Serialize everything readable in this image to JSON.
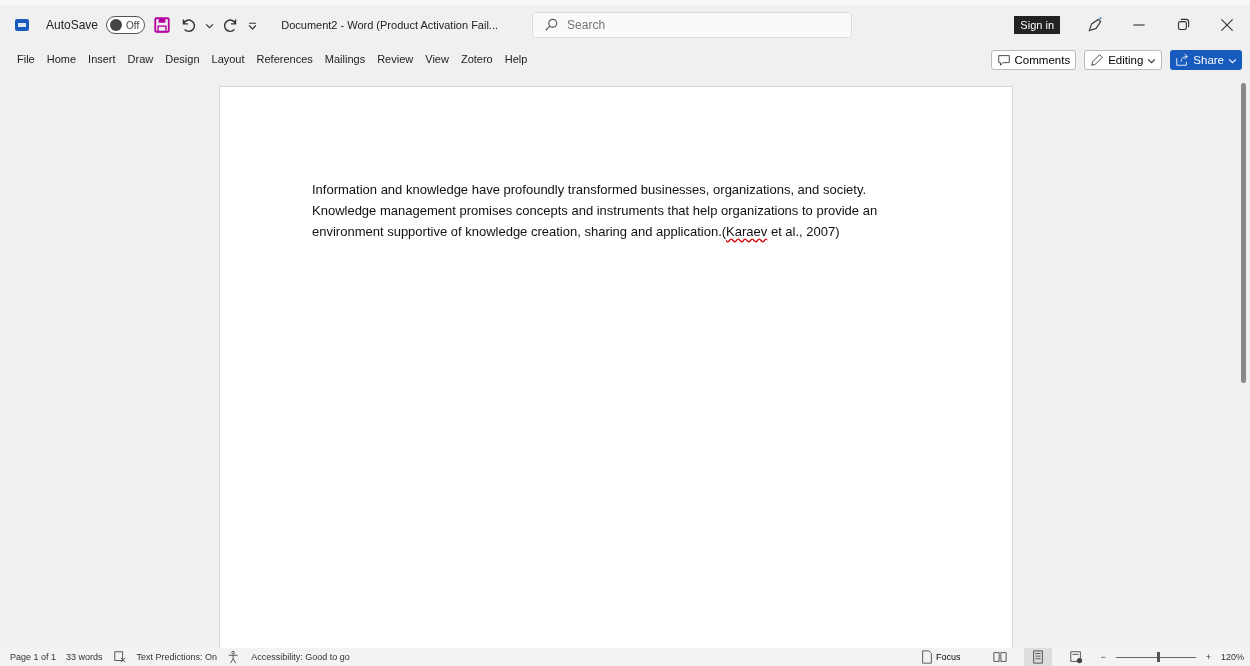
{
  "title_bar": {
    "autosave_label": "AutoSave",
    "autosave": {
      "on": false,
      "label": "Off"
    },
    "document_title": "Document2  -  Word (Product Activation Fail...",
    "search": {
      "placeholder": "Search"
    },
    "sign_in": "Sign in"
  },
  "ribbon_tabs": [
    {
      "label": "File",
      "selected": false
    },
    {
      "label": "Home",
      "selected": false
    },
    {
      "label": "Insert",
      "selected": false
    },
    {
      "label": "Draw",
      "selected": false
    },
    {
      "label": "Design",
      "selected": false
    },
    {
      "label": "Layout",
      "selected": false
    },
    {
      "label": "References",
      "selected": false
    },
    {
      "label": "Mailings",
      "selected": false
    },
    {
      "label": "Review",
      "selected": false
    },
    {
      "label": "View",
      "selected": false
    },
    {
      "label": "Zotero",
      "selected": false
    },
    {
      "label": "Help",
      "selected": false
    }
  ],
  "actions": {
    "comments": "Comments",
    "editing": "Editing",
    "share": "Share"
  },
  "document": {
    "lines": [
      [
        {
          "text": "Information and knowledge have profoundly transformed businesses, organizations, and society.",
          "misspelled": false
        }
      ],
      [
        {
          "text": "Knowledge management promises concepts and instruments that help organizations to provide an",
          "misspelled": false
        }
      ],
      [
        {
          "text": "environment supportive of knowledge creation, sharing and application.(",
          "misspelled": false
        },
        {
          "text": "Karaev",
          "misspelled": true
        },
        {
          "text": " et al., 2007)",
          "misspelled": false
        }
      ]
    ]
  },
  "status_bar": {
    "page": "Page 1 of 1",
    "words": "33 words",
    "text_predictions": "Text Predictions: On",
    "accessibility": "Accessibility: Good to go",
    "focus": "Focus",
    "views": [
      {
        "kind": "read",
        "selected": false
      },
      {
        "kind": "print",
        "selected": true
      },
      {
        "kind": "web",
        "selected": false
      }
    ],
    "zoom": {
      "minus": "−",
      "plus": "+",
      "level": 0.53,
      "reading": "120%"
    }
  }
}
